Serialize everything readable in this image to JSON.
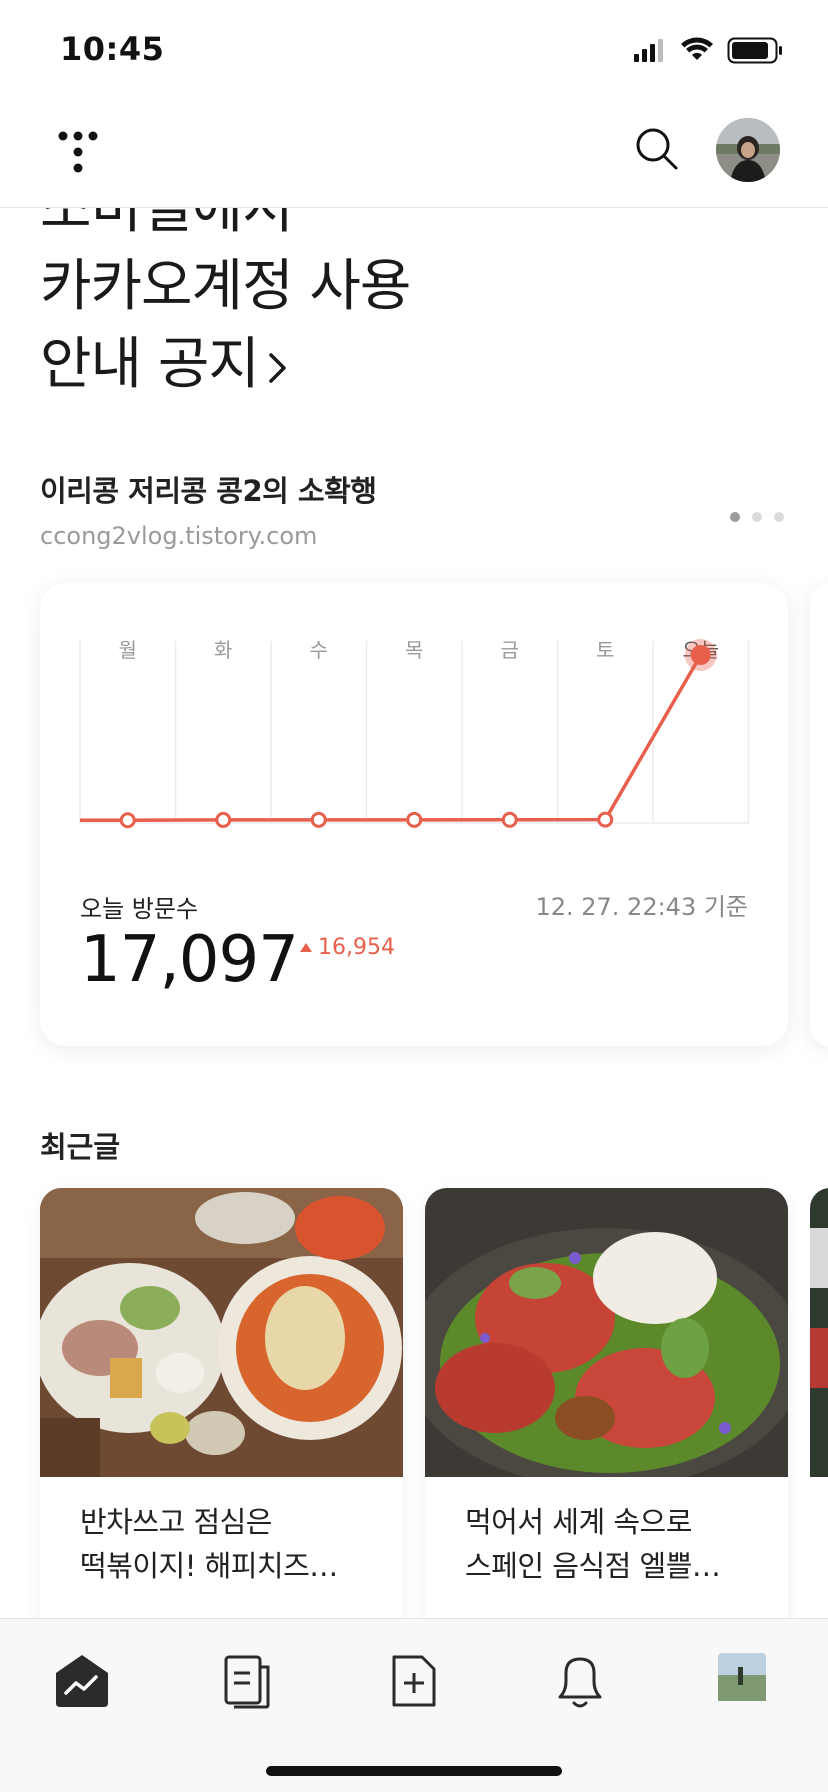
{
  "status_bar": {
    "time": "10:45"
  },
  "header": {
    "logo_icon": "tistory-logo-icon",
    "search_icon": "search-icon",
    "avatar_icon": "profile-avatar"
  },
  "notice": {
    "lines": [
      "소비킬에서",
      "카카오계정 사용",
      "안내 공지"
    ]
  },
  "blog": {
    "name": "이리콩 저리콩 콩2의 소확행",
    "url": "ccong2vlog.tistory.com"
  },
  "stats": {
    "visit_label": "오늘 방문수",
    "timestamp": "12. 27. 22:43 기준",
    "today_count": "17,097",
    "delta": "16,954",
    "line_color": "#e8604c"
  },
  "chart_data": {
    "type": "line",
    "categories": [
      "월",
      "화",
      "수",
      "목",
      "금",
      "토",
      "오늘"
    ],
    "series": [
      {
        "values": [
          80,
          110,
          120,
          120,
          125,
          143,
          17097
        ]
      }
    ]
  },
  "recent": {
    "title": "최근글",
    "posts": [
      {
        "title_line1": "반차쓰고 점심은",
        "title_line2": "떡볶이지! 해피치즈…"
      },
      {
        "title_line1": "먹어서 세계 속으로",
        "title_line2": "스페인 음식점 엘쁠…"
      }
    ]
  },
  "tabs": [
    {
      "icon": "stats-home-icon",
      "active": true
    },
    {
      "icon": "posts-icon"
    },
    {
      "icon": "new-post-icon"
    },
    {
      "icon": "notification-bell-icon"
    },
    {
      "icon": "blog-thumbnail"
    }
  ]
}
